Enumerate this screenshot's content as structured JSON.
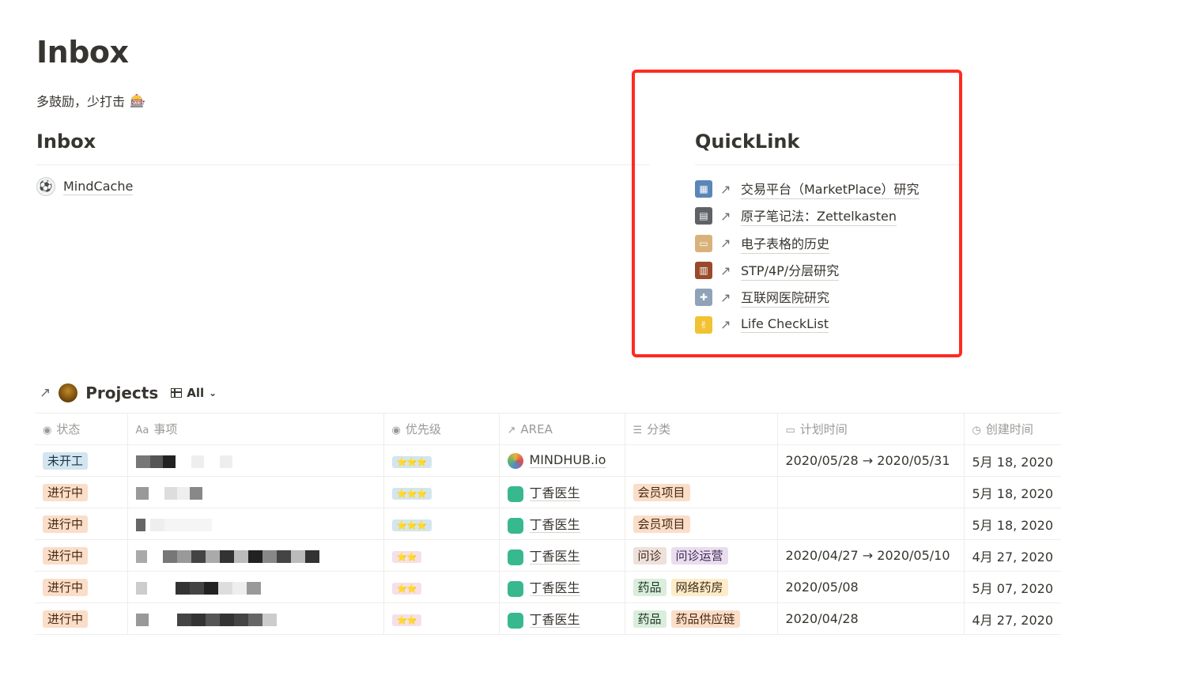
{
  "page": {
    "title": "Inbox",
    "subtitle": "多鼓励，少打击",
    "subtitle_emoji": "🎰"
  },
  "inbox": {
    "heading": "Inbox",
    "items": [
      {
        "label": "MindCache",
        "icon": "soccer-ball-icon",
        "glyph": "⚽"
      }
    ]
  },
  "quicklink": {
    "heading": "QuickLink",
    "arrow": "↗",
    "items": [
      {
        "label": "交易平台（MarketPlace）研究",
        "icon": "office-building-icon",
        "color": "#5a86b8",
        "glyph": "▦"
      },
      {
        "label": "原子笔记法：Zettelkasten",
        "icon": "file-cabinet-icon",
        "color": "#5f6368",
        "glyph": "▤"
      },
      {
        "label": "电子表格的历史",
        "icon": "package-icon",
        "color": "#d9b27b",
        "glyph": "▭"
      },
      {
        "label": "STP/4P/分层研究",
        "icon": "abacus-icon",
        "color": "#9a4a2a",
        "glyph": "▥"
      },
      {
        "label": "互联网医院研究",
        "icon": "hospital-icon",
        "color": "#8fa3b8",
        "glyph": "✚"
      },
      {
        "label": "Life CheckList",
        "icon": "rock-on-hand-icon",
        "color": "#f1c232",
        "glyph": "✌"
      }
    ]
  },
  "projects": {
    "arrow": "↗",
    "title": "Projects",
    "view": "All",
    "columns": [
      {
        "label": "状态",
        "icon": "status-icon",
        "glyph": "◉"
      },
      {
        "label": "事项",
        "icon": "text-aa-icon",
        "glyph": "Aa"
      },
      {
        "label": "优先级",
        "icon": "select-icon",
        "glyph": "◉"
      },
      {
        "label": "AREA",
        "icon": "relation-arrow-icon",
        "glyph": "↗"
      },
      {
        "label": "分类",
        "icon": "multi-select-icon",
        "glyph": "☰"
      },
      {
        "label": "计划时间",
        "icon": "calendar-icon",
        "glyph": "▭"
      },
      {
        "label": "创建时间",
        "icon": "clock-icon",
        "glyph": "◷"
      }
    ],
    "rows": [
      {
        "status": "未开工",
        "status_color": "blue",
        "priority": "⭐⭐⭐",
        "priority_color": "blue",
        "area": "MINDHUB.io",
        "area_icon": "mh",
        "tags": [],
        "plan": "2020/05/28 → 2020/05/31",
        "created": "5月 18, 2020"
      },
      {
        "status": "进行中",
        "status_color": "orange",
        "priority": "⭐⭐⭐",
        "priority_color": "blue",
        "area": "丁香医生",
        "area_icon": "green",
        "tags": [
          {
            "label": "会员项目",
            "color": "orange"
          }
        ],
        "plan": "",
        "created": "5月 18, 2020"
      },
      {
        "status": "进行中",
        "status_color": "orange",
        "priority": "⭐⭐⭐",
        "priority_color": "blue",
        "area": "丁香医生",
        "area_icon": "green",
        "tags": [
          {
            "label": "会员项目",
            "color": "orange"
          }
        ],
        "plan": "",
        "created": "5月 18, 2020"
      },
      {
        "status": "进行中",
        "status_color": "orange",
        "priority": "⭐⭐",
        "priority_color": "pink",
        "area": "丁香医生",
        "area_icon": "green",
        "tags": [
          {
            "label": "问诊",
            "color": "brown"
          },
          {
            "label": "问诊运营",
            "color": "purple"
          }
        ],
        "plan": "2020/04/27 → 2020/05/10",
        "created": "4月 27, 2020"
      },
      {
        "status": "进行中",
        "status_color": "orange",
        "priority": "⭐⭐",
        "priority_color": "pink",
        "area": "丁香医生",
        "area_icon": "green",
        "tags": [
          {
            "label": "药品",
            "color": "green"
          },
          {
            "label": "网络药房",
            "color": "yellow"
          }
        ],
        "plan": "2020/05/08",
        "created": "5月 07, 2020"
      },
      {
        "status": "进行中",
        "status_color": "orange",
        "priority": "⭐⭐",
        "priority_color": "pink",
        "area": "丁香医生",
        "area_icon": "green",
        "tags": [
          {
            "label": "药品",
            "color": "green"
          },
          {
            "label": "药品供应链",
            "color": "orange"
          }
        ],
        "plan": "2020/04/28",
        "created": "4月 27, 2020"
      }
    ]
  }
}
